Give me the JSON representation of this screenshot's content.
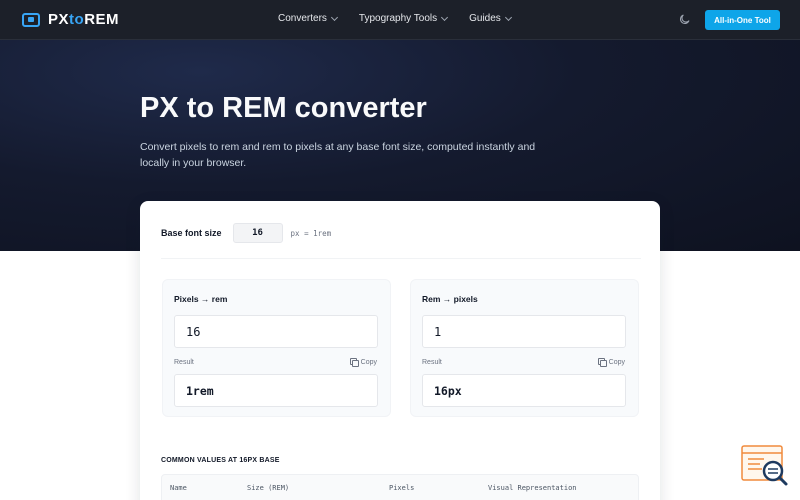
{
  "nav": {
    "logo_left": "PX",
    "logo_mid": "to",
    "logo_right": "REM",
    "menu": [
      {
        "label": "Converters"
      },
      {
        "label": "Typography Tools"
      },
      {
        "label": "Guides"
      }
    ],
    "theme_icon": "moon-icon",
    "cta_label": "All-in-One Tool"
  },
  "hero": {
    "title": "PX to REM converter",
    "subtitle": "Convert pixels to rem and rem to pixels at any base font size, computed instantly and locally in your browser."
  },
  "base": {
    "label": "Base font size",
    "value": "16",
    "unit": "px = 1rem"
  },
  "px_to_rem": {
    "title": "Pixels → rem",
    "input_value": "16",
    "result_label": "Result",
    "copy_label": "Copy",
    "result_value": "1rem"
  },
  "rem_to_px": {
    "title": "Rem → pixels",
    "input_value": "1",
    "result_label": "Result",
    "copy_label": "Copy",
    "result_value": "16px"
  },
  "common": {
    "title": "COMMON VALUES AT 16PX BASE",
    "columns": [
      "Name",
      "Size (REM)",
      "Pixels",
      "Visual Representation"
    ]
  },
  "colors": {
    "accent": "#0ea5e9",
    "nav_bg": "#1c2029",
    "hero_bg": "#141a2e"
  }
}
